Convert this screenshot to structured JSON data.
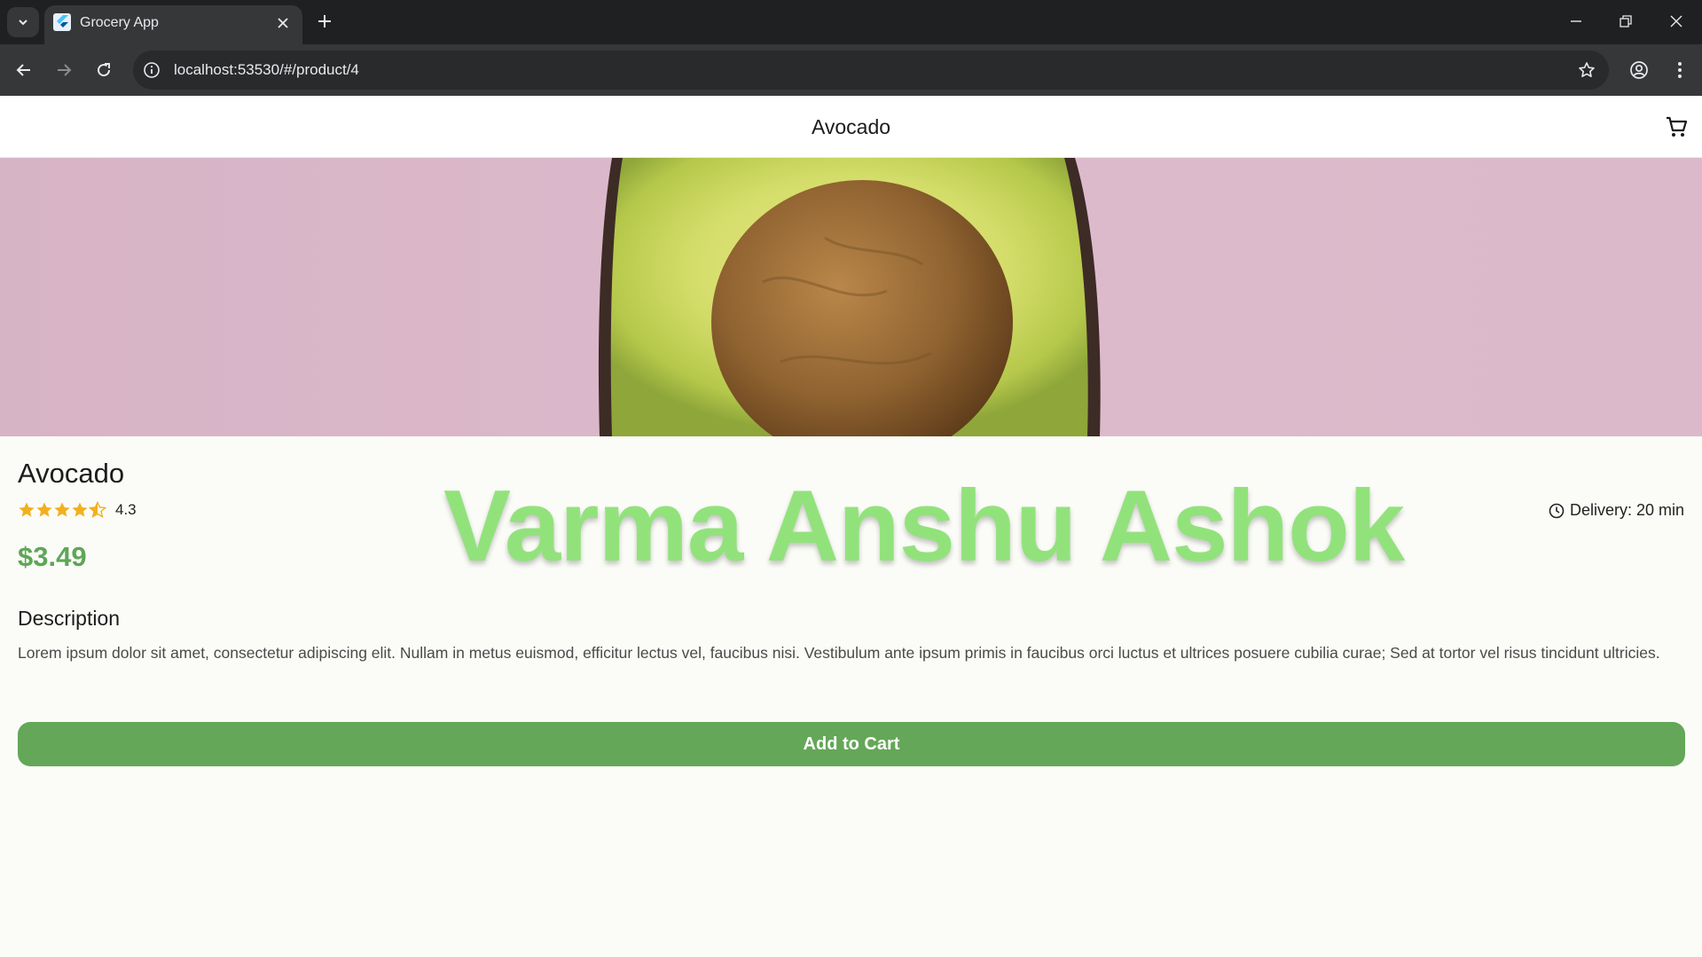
{
  "browser": {
    "tab_title": "Grocery App",
    "url": "localhost:53530/#/product/4",
    "icons": [
      "tab-search-icon",
      "flutter-favicon-icon",
      "close-icon",
      "plus-icon",
      "minimize-icon",
      "restore-icon",
      "close-window-icon",
      "back-arrow-icon",
      "forward-arrow-icon",
      "reload-icon",
      "site-info-icon",
      "bookmark-star-icon",
      "profile-icon",
      "more-vert-icon"
    ]
  },
  "appbar": {
    "title": "Avocado",
    "cart_icon": "shopping-cart-icon"
  },
  "product": {
    "name": "Avocado",
    "rating": 4.3,
    "rating_text": "4.3",
    "price": "$3.49",
    "delivery": "Delivery: 20 min",
    "description_title": "Description",
    "description": "Lorem ipsum dolor sit amet, consectetur adipiscing elit. Nullam in metus euismod, efficitur lectus vel, faucibus nisi. Vestibulum ante ipsum primis in faucibus orci luctus et ultrices posuere cubilia curae; Sed at tortor vel risus tincidunt ultricies.",
    "add_to_cart": "Add to Cart"
  },
  "watermark": "Varma Anshu Ashok",
  "colors": {
    "accent_green": "#64a758",
    "price_green": "#5fa658",
    "watermark_green": "#92e27c",
    "star": "#f2b01e",
    "hero_bg": "#dbb8ca"
  }
}
